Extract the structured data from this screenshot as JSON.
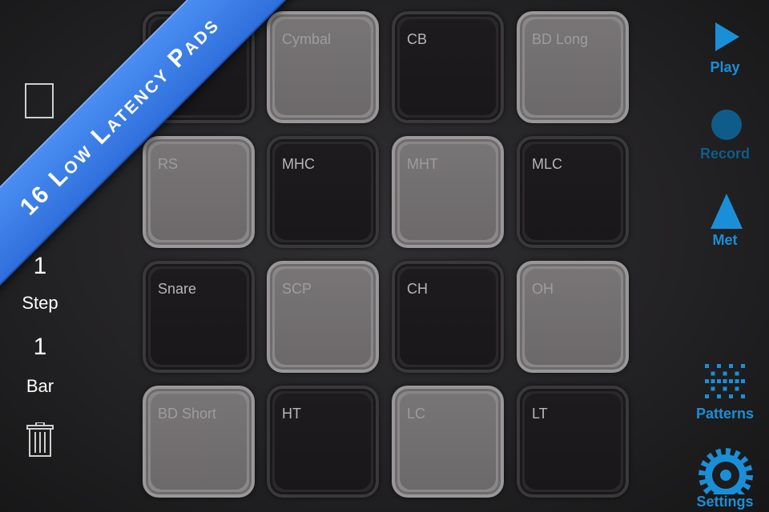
{
  "banner": {
    "text": "16 Low Latency Pads"
  },
  "left_panel": {
    "step_value": "1",
    "step_label": "Step",
    "bar_value": "1",
    "bar_label": "Bar"
  },
  "pads": [
    {
      "label": "",
      "shade": "dark"
    },
    {
      "label": "Cymbal",
      "shade": "light"
    },
    {
      "label": "CB",
      "shade": "dark"
    },
    {
      "label": "BD Long",
      "shade": "light"
    },
    {
      "label": "RS",
      "shade": "light"
    },
    {
      "label": "MHC",
      "shade": "dark"
    },
    {
      "label": "MHT",
      "shade": "light"
    },
    {
      "label": "MLC",
      "shade": "dark"
    },
    {
      "label": "Snare",
      "shade": "dark"
    },
    {
      "label": "SCP",
      "shade": "light"
    },
    {
      "label": "CH",
      "shade": "dark"
    },
    {
      "label": "OH",
      "shade": "light"
    },
    {
      "label": "BD Short",
      "shade": "light"
    },
    {
      "label": "HT",
      "shade": "dark"
    },
    {
      "label": "LC",
      "shade": "light"
    },
    {
      "label": "LT",
      "shade": "dark"
    }
  ],
  "transport": {
    "play_label": "Play",
    "record_label": "Record",
    "met_label": "Met",
    "patterns_label": "Patterns",
    "settings_label": "Settings"
  },
  "colors": {
    "accent": "#1a8fd8",
    "record_dim": "#0f5c8a",
    "banner_blue": "#3b7de6"
  },
  "icons": {
    "play": "play-triangle-icon",
    "record": "record-circle-icon",
    "met": "metronome-triangle-icon",
    "patterns": "patterns-grid-icon",
    "settings": "gear-icon",
    "trash": "trash-icon"
  }
}
